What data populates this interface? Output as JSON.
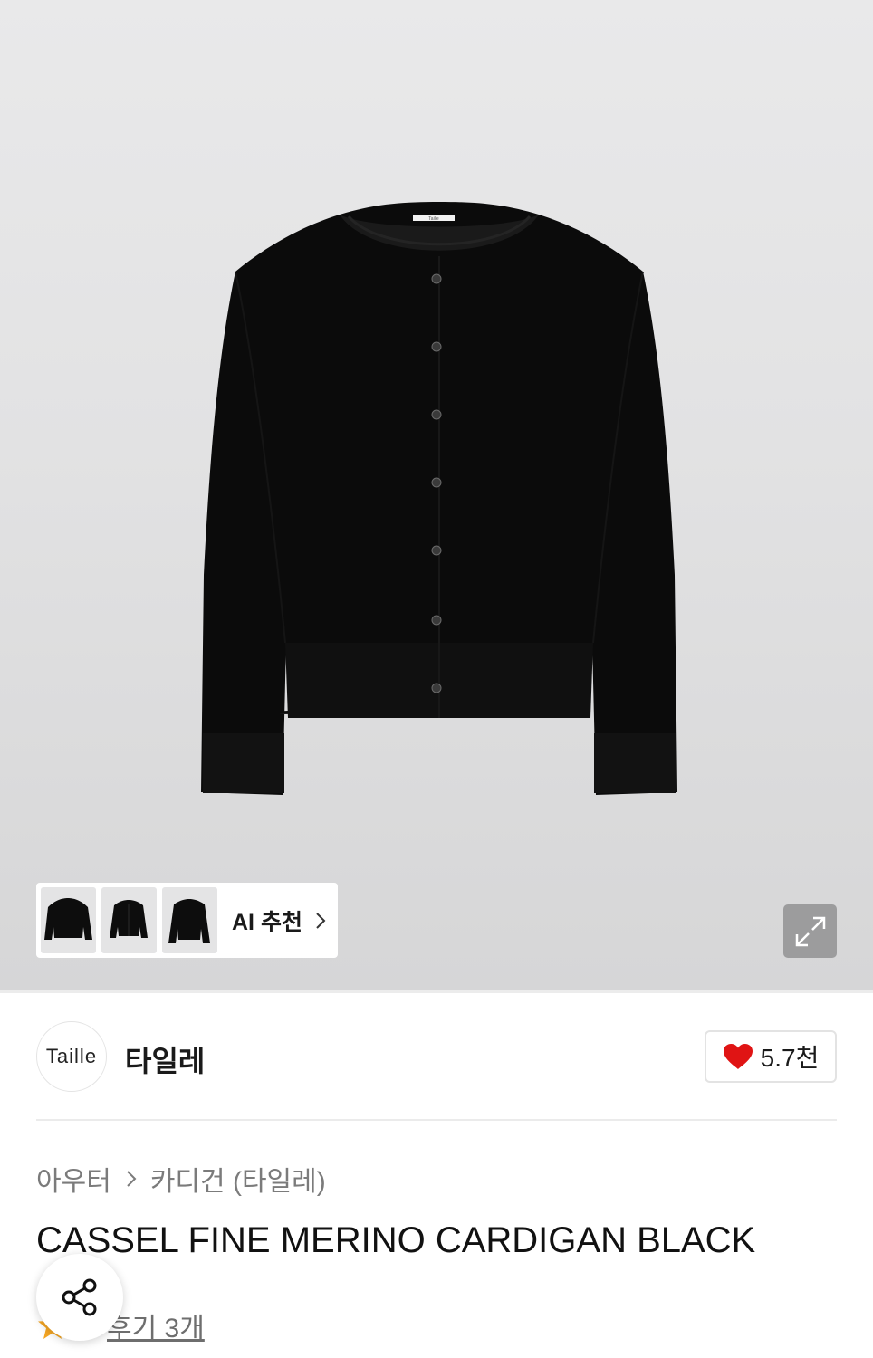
{
  "colors": {
    "accent_heart": "#e01414",
    "star": "#f5a623",
    "text_secondary": "#7b7b7b"
  },
  "hero": {
    "main_image_alt": "Black button cardigan product photo",
    "label_on_product": "Taille",
    "thumbnails": [
      {
        "icon": "cardigan-thumbnail-1"
      },
      {
        "icon": "cardigan-thumbnail-2"
      },
      {
        "icon": "cardigan-thumbnail-3"
      }
    ],
    "ai_recommend_label": "AI 추천",
    "expand_icon": "expand-icon"
  },
  "brand": {
    "logo_text": "Taille",
    "name": "타일레",
    "like_count": "5.7천"
  },
  "breadcrumb": {
    "items": [
      "아우터",
      "카디건 (타일레)"
    ]
  },
  "product": {
    "title": "CASSEL FINE MERINO CARDIGAN BLACK"
  },
  "reviews": {
    "label": "후기 3개"
  }
}
